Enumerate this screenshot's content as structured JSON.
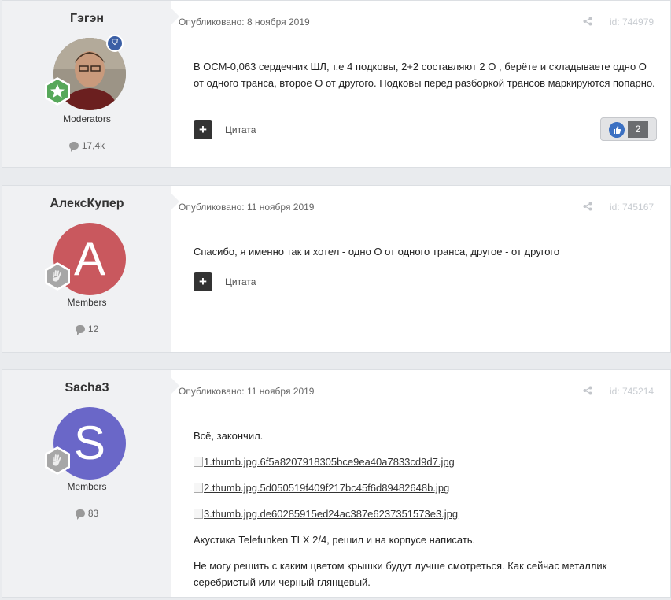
{
  "posts": [
    {
      "author": "Гэгэн",
      "group": "Moderators",
      "count": "17,4k",
      "published": "Опубликовано: 8 ноября 2019",
      "id": "id: 744979",
      "paragraphs": [
        "В ОСМ-0,063 сердечник ШЛ, т.е 4 подковы, 2+2 составляют 2 О ,   берёте и складываете одно О от одного транса, второе О от другого.   Подковы перед разборкой трансов маркируются попарно."
      ],
      "quote_label": "Цитата",
      "likes": "2"
    },
    {
      "author": "АлексКупер",
      "avatar_letter": "A",
      "avatar_color": "#c9585e",
      "group": "Members",
      "count": "12",
      "published": "Опубликовано: 11 ноября 2019",
      "id": "id: 745167",
      "paragraphs": [
        "Спасибо, я именно так и хотел - одно О от одного транса, другое - от другого"
      ],
      "quote_label": "Цитата"
    },
    {
      "author": "Sacha3",
      "avatar_letter": "S",
      "avatar_color": "#6a67c8",
      "group": "Members",
      "count": "83",
      "published": "Опубликовано: 11 ноября 2019",
      "id": "id: 745214",
      "intro": "Всё, закончил.",
      "attachments": [
        "1.thumb.jpg.6f5a8207918305bce9ea40a7833cd9d7.jpg",
        "2.thumb.jpg.5d050519f409f217bc45f6d89482648b.jpg",
        "3.thumb.jpg.de60285915ed24ac387e6237351573e3.jpg"
      ],
      "paragraphs": [
        "Акустика Telefunken TLX 2/4, решил и на корпусе написать.",
        "Не могу решить с каким цветом крышки будут лучше смотреться. Как сейчас металлик серебристый или черный глянцевый."
      ]
    }
  ]
}
